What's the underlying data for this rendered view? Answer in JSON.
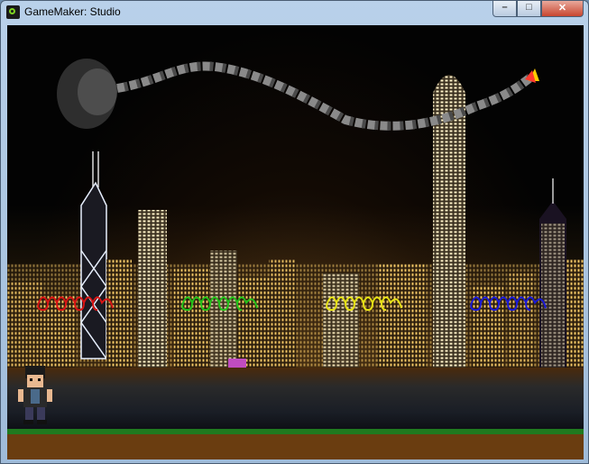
{
  "window": {
    "title": "GameMaker: Studio",
    "controls": {
      "minimize": "–",
      "maximize": "□",
      "close": "✕"
    }
  },
  "game": {
    "sky_color": "#030303",
    "moon_color": "#3a3a3a",
    "rope_colors": [
      "#8a8a8a",
      "#4a4a4a"
    ],
    "worms": [
      {
        "color": "red",
        "hex": "#d81414"
      },
      {
        "color": "green",
        "hex": "#22c21a"
      },
      {
        "color": "yellow",
        "hex": "#e6e215"
      },
      {
        "color": "blue",
        "hex": "#1a1ad8"
      }
    ],
    "ground": {
      "grass": "#1f7a1f",
      "dirt": "#6a3d10"
    }
  }
}
